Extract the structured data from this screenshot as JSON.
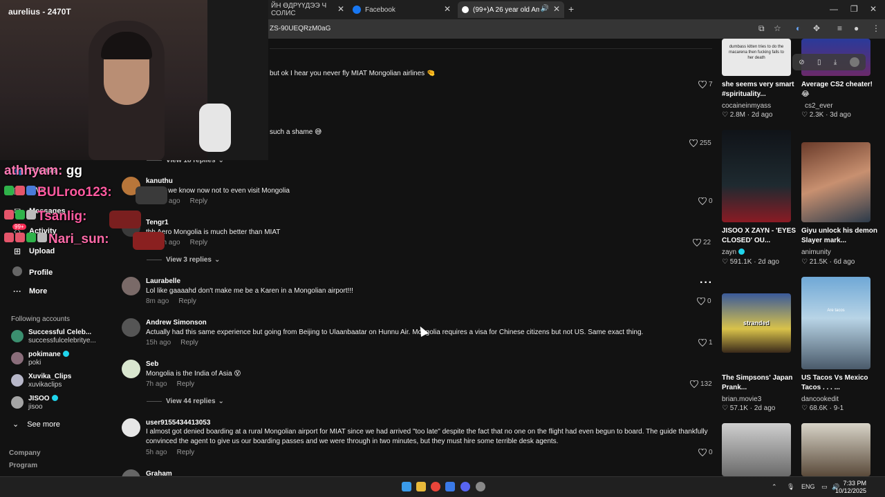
{
  "browser": {
    "tabs": [
      {
        "label": "ЙН ӨДРҮҮДЭЭ Ч СОЛИС"
      },
      {
        "label": "Facebook"
      },
      {
        "label": "(99+)A 26 year old America"
      }
    ],
    "url": "ZS-90UEQRzM0aG"
  },
  "webcam": {
    "name": "aurelius - 2470T"
  },
  "chat": [
    {
      "user": "athhyam:",
      "message": "gg"
    },
    {
      "user": "BULroo123:",
      "message": ""
    },
    {
      "user": "Tsanlig:",
      "message": ""
    },
    {
      "user": "Nari_sun:",
      "message": ""
    }
  ],
  "sidebar": {
    "nav": [
      {
        "label": "Friends"
      },
      {
        "label": "LIVE"
      },
      {
        "label": "Messages",
        "badge": "99+"
      },
      {
        "label": "Activity"
      },
      {
        "label": "Upload"
      },
      {
        "label": "Profile"
      },
      {
        "label": "More"
      }
    ],
    "following_title": "Following accounts",
    "accounts": [
      {
        "name": "Successful Celeb...",
        "username": "successfulcelebritye..."
      },
      {
        "name": "pokimane",
        "username": "poki",
        "verified": true
      },
      {
        "name": "Xuvika_Clips",
        "username": "xuvikaclips"
      },
      {
        "name": "JISOO",
        "username": "jisoo",
        "verified": true
      }
    ],
    "see_more": "See more",
    "footer": [
      "Company",
      "Program"
    ]
  },
  "comments": [
    {
      "user": "",
      "text": "but ok I hear you never fly MIAT Mongolian airlines 🤏",
      "meta": "",
      "likes": "7"
    },
    {
      "user": "",
      "text": "such a shame 😅",
      "meta": "",
      "likes": "255"
    },
    {
      "replies": "View 18 replies"
    },
    {
      "user": "kanuthu",
      "text": "thanks we know now not to even visit Mongolia",
      "meta": "6h ago",
      "likes": "0"
    },
    {
      "user": "Tengr1",
      "text": "tbh Aero Mongolia is much better than MIAT",
      "meta": "3h ago",
      "likes": "22"
    },
    {
      "replies": "View 3 replies"
    },
    {
      "user": "Laurabelle",
      "text": "Lol like gaaaahd don't make me be a Karen in a Mongolian airport!!!",
      "meta": "8m ago",
      "likes": "0"
    },
    {
      "user": "Andrew Simonson",
      "text": "Actually had this same experience but going from Beijing to Ulaanbaatar on Hunnu Air. Mongolia requires a visa for Chinese citizens but not US. Same exact thing.",
      "meta": "15h ago",
      "likes": "1"
    },
    {
      "user": "Seb",
      "text": "Mongolia is the India of Asia 😵",
      "meta": "7h ago",
      "likes": "132"
    },
    {
      "replies": "View 44 replies"
    },
    {
      "user": "user9155434413053",
      "text": "I almost got denied boarding at a rural Mongolian airport for MIAT since we had arrived \"too late\" despite the fact that no one on the flight had even begun to board. The guide thankfully convinced the agent to give us our boarding passes and we were through in two minutes, but they must hire some terrible desk agents.",
      "meta": "5h ago",
      "likes": "0"
    },
    {
      "user": "Graham",
      "text": "",
      "meta": "",
      "likes": ""
    }
  ],
  "reply_label": "Reply",
  "videos": [
    {
      "title": "she seems very smart #spirituality...",
      "author": "cocaineinmyass",
      "stats": "2.8M · 2d ago",
      "thumb_text": "dumbass kitten tries to do the macarena then fucking falls to her death"
    },
    {
      "title": "Average CS2 cheater! 😂",
      "author": "cs2_ever",
      "stats": "2.3K · 3d ago"
    },
    {
      "title": "JISOO X ZAYN - 'EYES CLOSED' OU...",
      "author": "zayn",
      "stats": "591.1K · 2d ago",
      "verified": true
    },
    {
      "title": "Giyu unlock his demon Slayer mark...",
      "author": "animunity",
      "stats": "21.5K · 6d ago"
    },
    {
      "title": "The Simpsons' Japan Prank...",
      "author": "brian.movie3",
      "stats": "57.1K · 2d ago",
      "thumb_text": "stranded"
    },
    {
      "title": "US Tacos Vs Mexico Tacos . . . ...",
      "author": "dancookedit",
      "stats": "68.6K · 9-1",
      "thumb_text": "Are tacos"
    }
  ],
  "taskbar": {
    "lang": "ENG",
    "time": "7:33 PM",
    "date": "10/12/2025"
  }
}
